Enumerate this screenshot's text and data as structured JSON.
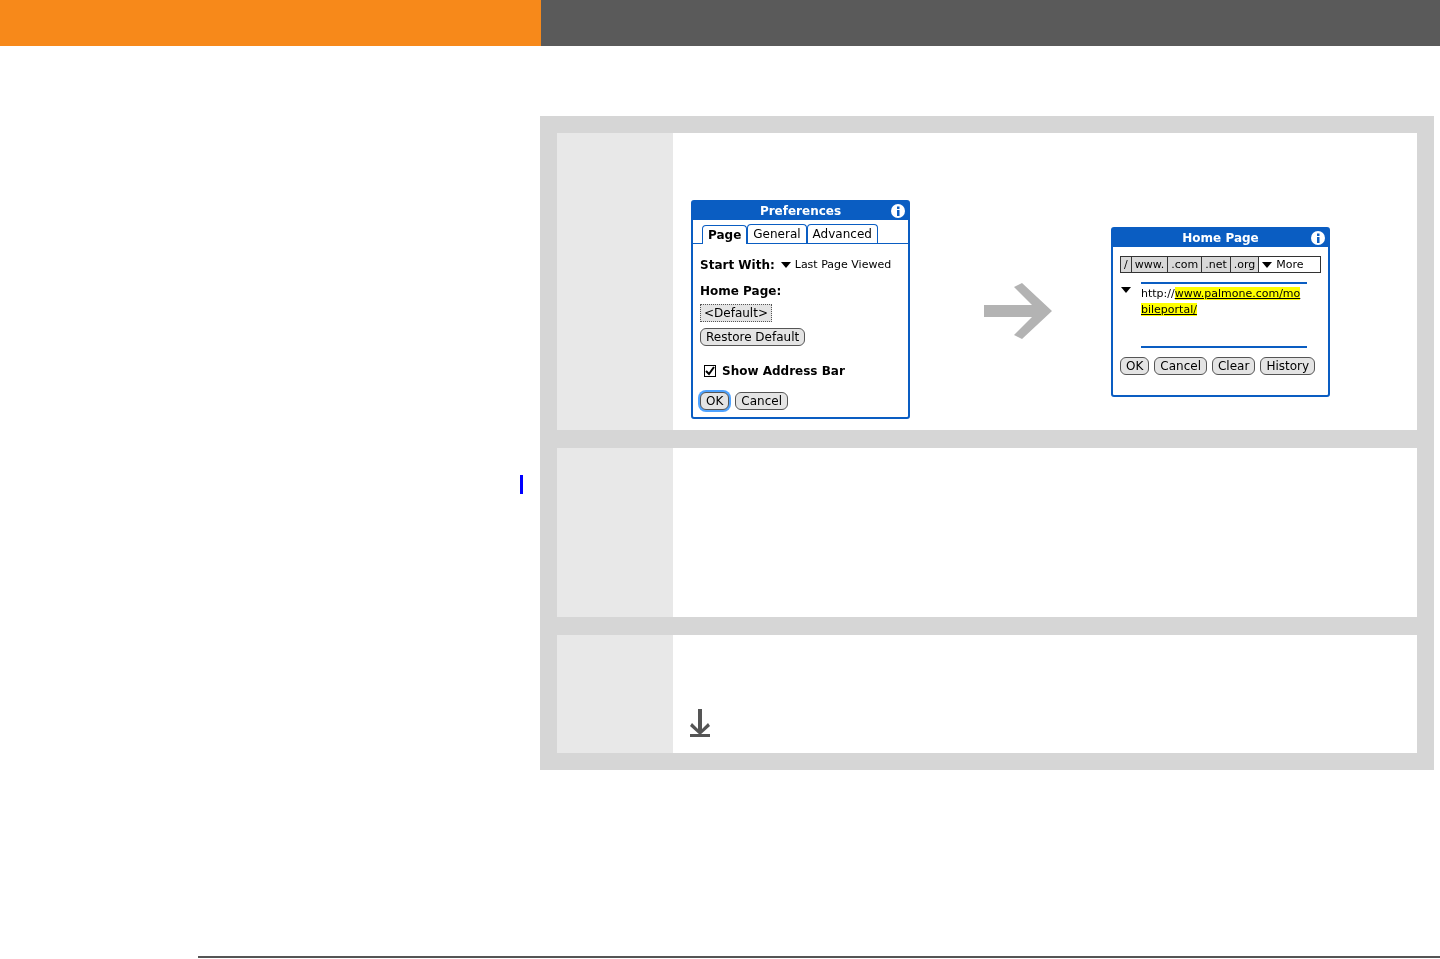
{
  "preferences_dialog": {
    "title": "Preferences",
    "tabs": [
      {
        "label": "Page",
        "selected": true
      },
      {
        "label": "General",
        "selected": false
      },
      {
        "label": "Advanced",
        "selected": false
      }
    ],
    "start_with": {
      "label": "Start With:",
      "value": "Last Page Viewed"
    },
    "home_page": {
      "label": "Home Page:",
      "value": "<Default>"
    },
    "restore_button": "Restore Default",
    "show_address_bar": {
      "label": "Show Address Bar",
      "checked": true
    },
    "buttons": [
      {
        "label": "OK",
        "focused": true
      },
      {
        "label": "Cancel",
        "focused": false
      }
    ]
  },
  "home_page_dialog": {
    "title": "Home Page",
    "shortcuts": [
      "/",
      "www.",
      ".com",
      ".net",
      ".org"
    ],
    "more": "More",
    "url": {
      "prefix": "http://",
      "selected_text": "www.palmone.com/mobileportal/"
    },
    "buttons": [
      {
        "label": "OK",
        "focused": false
      },
      {
        "label": "Cancel",
        "focused": false
      },
      {
        "label": "Clear",
        "focused": false
      },
      {
        "label": "History",
        "focused": false
      }
    ]
  }
}
